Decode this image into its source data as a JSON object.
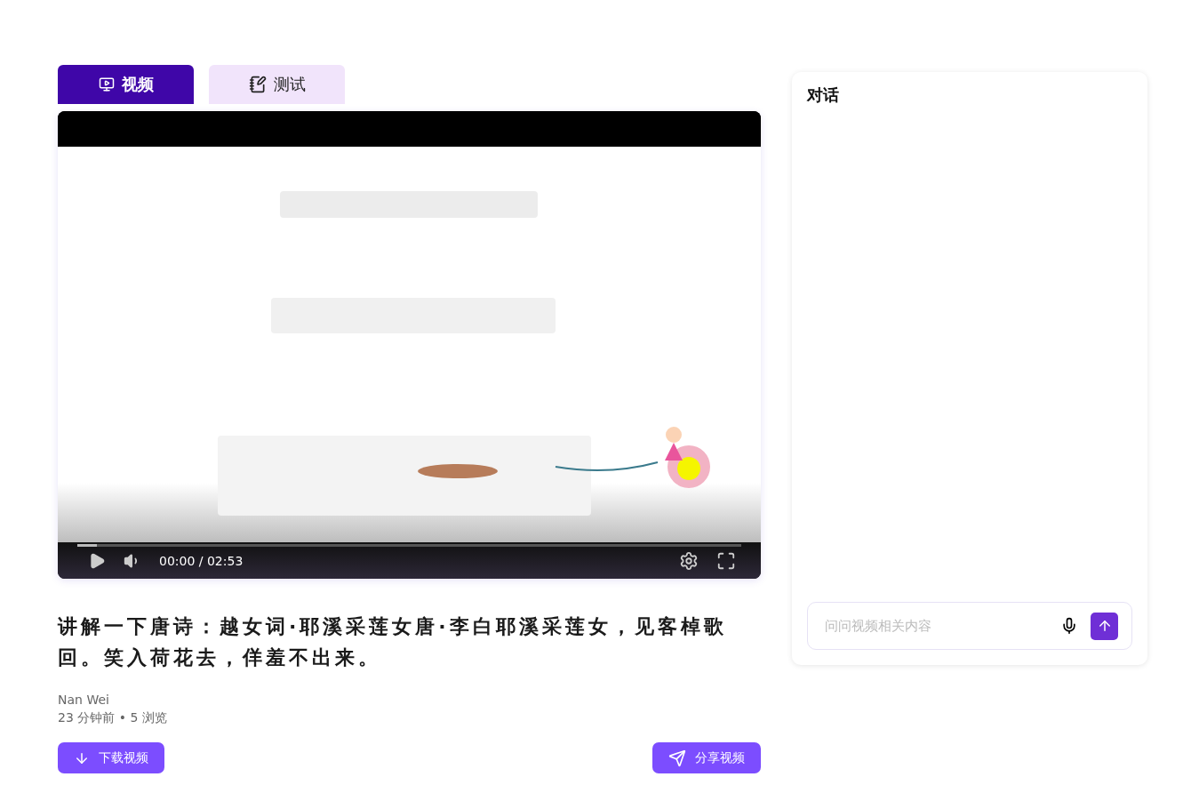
{
  "tabs": [
    {
      "label": "视频",
      "kind": "video",
      "selected": true
    },
    {
      "label": "测试",
      "kind": "notebook",
      "selected": false
    }
  ],
  "video": {
    "progress": {
      "level": 0.03
    },
    "time": "00:00 / 02:53"
  },
  "title": "讲解一下唐诗：越女词·耶溪采莲女唐·李白耶溪采莲女，见客棹歌回。笑入荷花去，佯羞不出来。",
  "author": "Nan Wei",
  "meta": "23 分钟前 • 5 浏览",
  "buttons": [
    {
      "label": "下载视频",
      "kind": "download"
    },
    {
      "label": "分享视频",
      "kind": "share"
    }
  ],
  "chat": {
    "title": "对话",
    "input": {
      "placeholder": "问问视频相关内容"
    }
  }
}
